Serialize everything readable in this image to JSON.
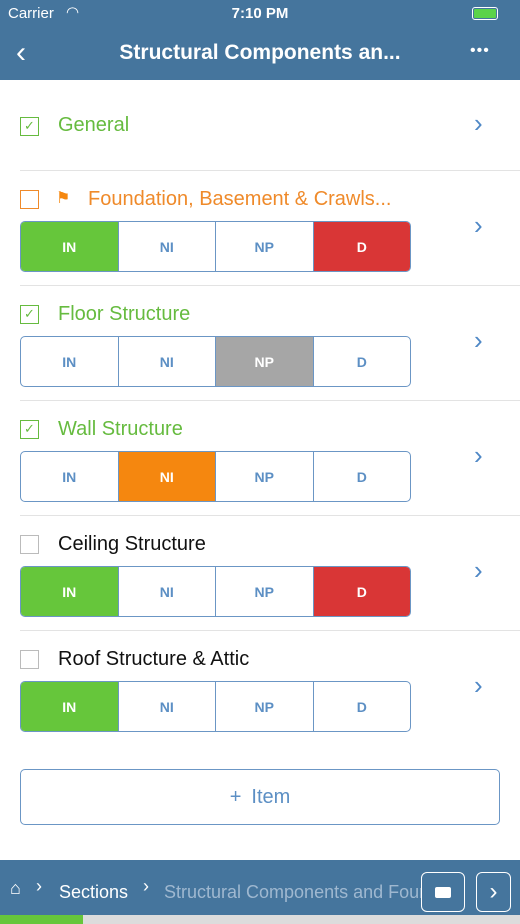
{
  "status": {
    "carrier": "Carrier",
    "time": "7:10 PM"
  },
  "nav": {
    "title": "Structural Components an...",
    "more": "•••"
  },
  "general": {
    "label": "General",
    "checked": true
  },
  "items": [
    {
      "label": "Foundation, Basement & Crawls...",
      "checked": false,
      "flagged": true,
      "color": "#ef8a2a",
      "selected": [
        "IN",
        "D"
      ]
    },
    {
      "label": "Floor Structure",
      "checked": true,
      "flagged": false,
      "color": "#66bb3f",
      "selected": [
        "NP"
      ]
    },
    {
      "label": "Wall Structure",
      "checked": true,
      "flagged": false,
      "color": "#66bb3f",
      "selected": [
        "NI"
      ]
    },
    {
      "label": "Ceiling Structure",
      "checked": false,
      "flagged": false,
      "color": "#111111",
      "selected": [
        "IN",
        "D"
      ]
    },
    {
      "label": "Roof Structure & Attic",
      "checked": false,
      "flagged": false,
      "color": "#111111",
      "selected": [
        "IN"
      ]
    }
  ],
  "segments": [
    "IN",
    "NI",
    "NP",
    "D"
  ],
  "segment_colors": {
    "IN": "#66c63b",
    "NI": "#f5870f",
    "NP": "#a6a6a6",
    "D": "#d93636"
  },
  "add_item": {
    "plus": "+",
    "label": "Item"
  },
  "breadcrumb": {
    "sections": "Sections",
    "current": "Structural Components and Foundation"
  },
  "progress_percent": 16
}
